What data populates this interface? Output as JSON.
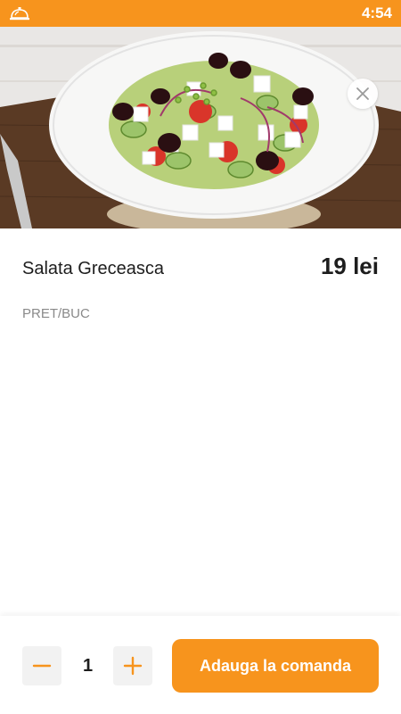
{
  "status_bar": {
    "time": "4:54",
    "app_icon": "service-bell-icon"
  },
  "product": {
    "name": "Salata Greceasca",
    "price": "19 lei",
    "unit": "PRET/BUC",
    "image": "greek-salad-photo"
  },
  "controls": {
    "close_icon": "close-icon",
    "minus_icon": "minus-icon",
    "plus_icon": "plus-icon",
    "quantity": "1",
    "add_button_label": "Adauga la comanda"
  },
  "colors": {
    "accent": "#f7941d",
    "text": "#1d1d1d",
    "muted": "#8a8a8a"
  }
}
